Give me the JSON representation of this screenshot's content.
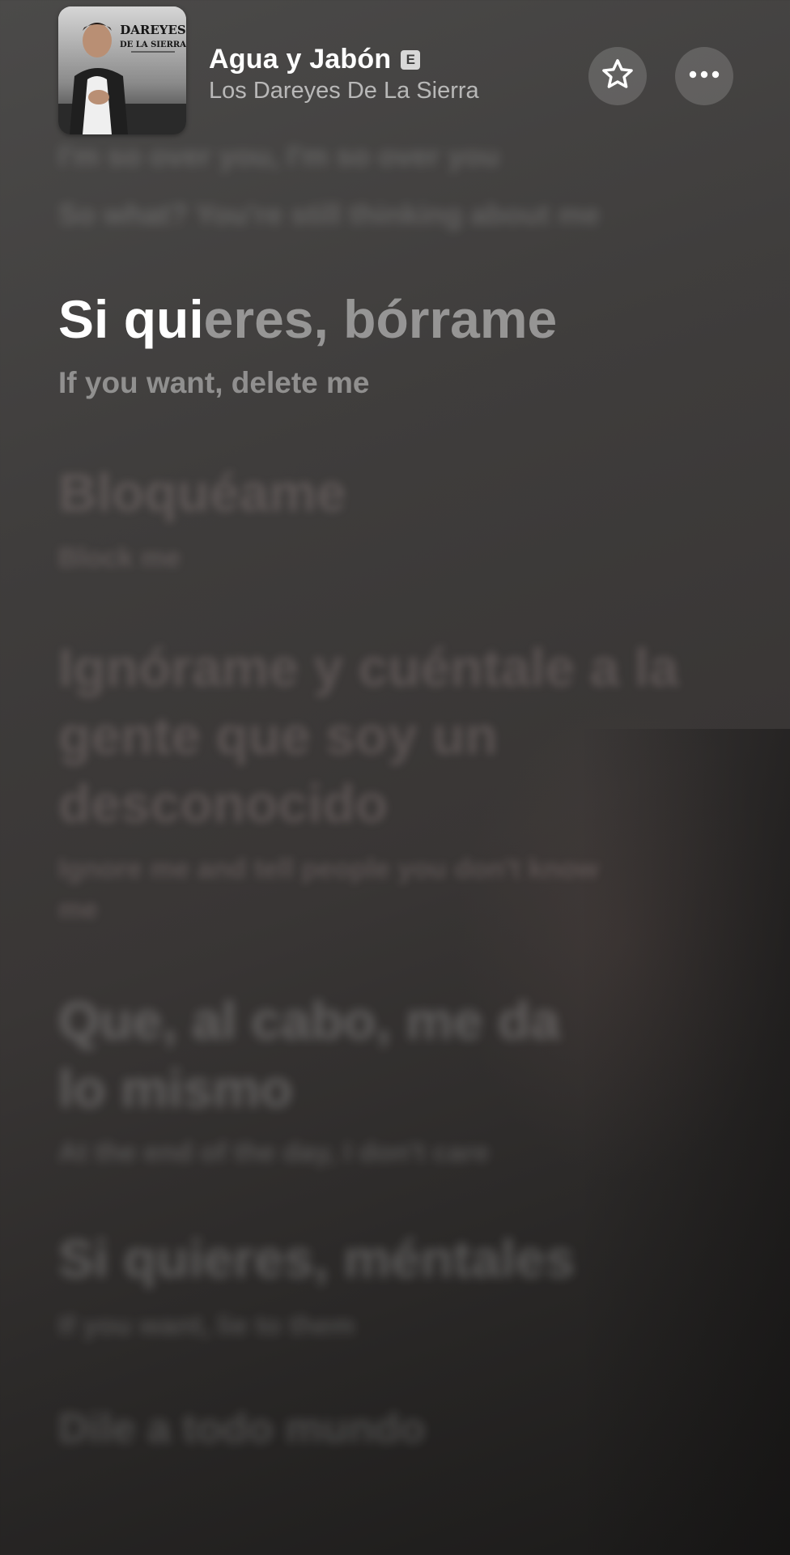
{
  "now_playing": {
    "title": "Agua y Jabón",
    "explicit_badge": "E",
    "artist": "Los Dareyes De La Sierra",
    "artwork_text": [
      "DAREYES",
      "DE LA SIERRA"
    ]
  },
  "actions": {
    "favorite_icon": "star-outline-icon",
    "more_icon": "ellipsis-icon"
  },
  "lyrics": {
    "previous": [
      "I'm so over you, I'm so over you",
      "So what? You're still thinking about me"
    ],
    "active": {
      "sung": "Si qui",
      "unsung": "eres, bórrame",
      "translation": "If you want, delete me"
    },
    "upcoming": [
      {
        "text": "Bloquéame",
        "translation": "Block me"
      },
      {
        "text": "Ignórame y cuéntale a la gente que soy un desconocido",
        "translation": "Ignore me and tell people you don't know me"
      },
      {
        "text": "Que, al cabo, me da lo mismo",
        "translation": "At the end of the day, I don't care"
      },
      {
        "text": "Si quieres, méntales",
        "translation": "If you want, lie to them"
      },
      {
        "text": "Dile a todo mundo",
        "translation": ""
      }
    ]
  },
  "colors": {
    "background_top": "#4b4a49",
    "background_bottom": "#1b1a19",
    "active_text": "#ffffff"
  }
}
